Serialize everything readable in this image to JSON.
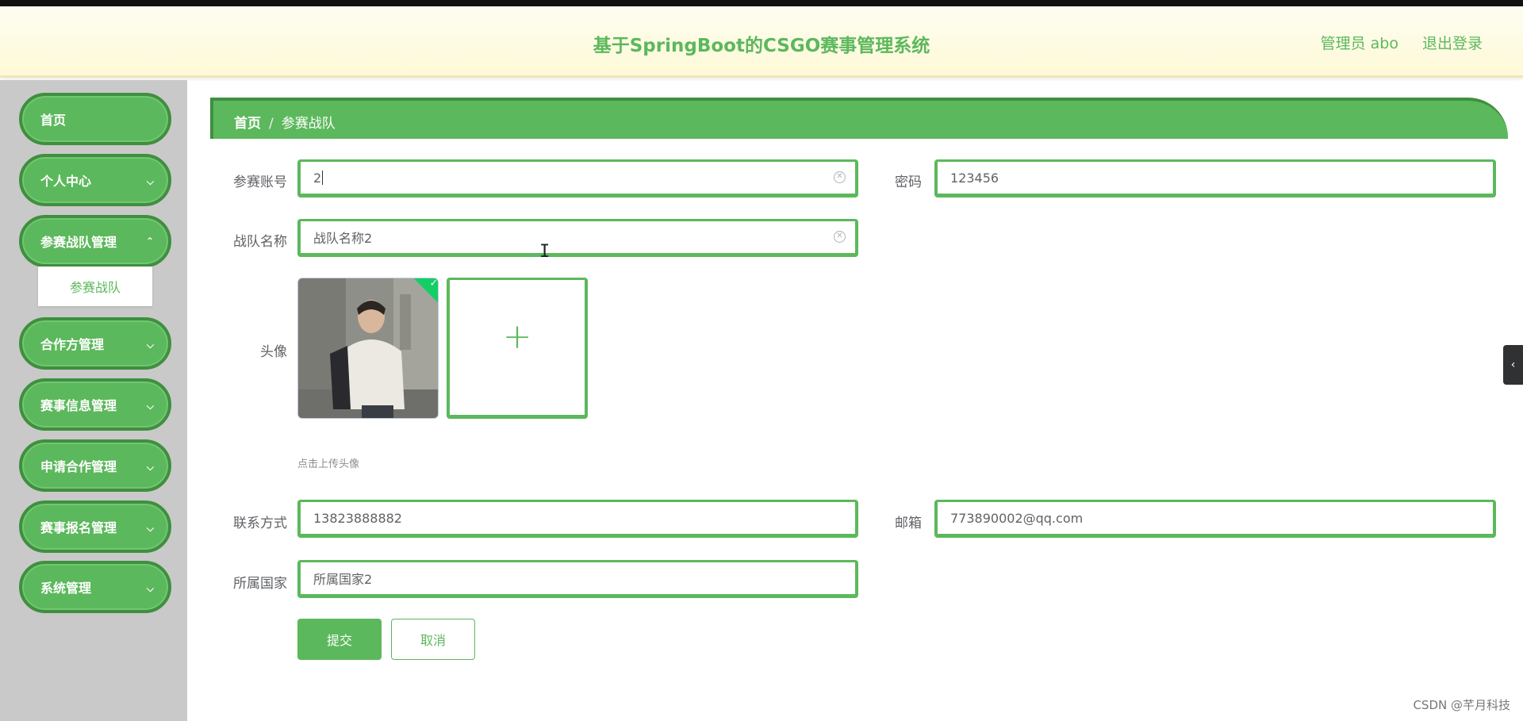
{
  "header": {
    "title": "基于SpringBoot的CSGO赛事管理系统",
    "user": "管理员 abo",
    "logout": "退出登录"
  },
  "sidebar": {
    "items": [
      {
        "label": "首页"
      },
      {
        "label": "个人中心"
      },
      {
        "label": "参赛战队管理"
      },
      {
        "label": "合作方管理"
      },
      {
        "label": "赛事信息管理"
      },
      {
        "label": "申请合作管理"
      },
      {
        "label": "赛事报名管理"
      },
      {
        "label": "系统管理"
      }
    ],
    "submenu_active": "参赛战队"
  },
  "breadcrumb": {
    "home": "首页",
    "separator": "/",
    "current": "参赛战队"
  },
  "form": {
    "account_label": "参赛账号",
    "account_value": "2",
    "password_label": "密码",
    "password_value": "123456",
    "team_name_label": "战队名称",
    "team_name_value": "战队名称2",
    "avatar_label": "头像",
    "upload_hint": "点击上传头像",
    "contact_label": "联系方式",
    "contact_value": "13823888882",
    "email_label": "邮箱",
    "email_value": "773890002@qq.com",
    "country_label": "所属国家",
    "country_value": "所属国家2",
    "submit": "提交",
    "cancel": "取消"
  },
  "icons": {
    "plus": "plus-icon",
    "clear": "clear-icon",
    "check": "check-icon",
    "chevron": "chevron-down-icon",
    "collapse": "chevron-left-icon"
  },
  "colors": {
    "accent": "#5cb85c",
    "accent_dark": "#3f8f3f",
    "sidebar_bg": "#ffe9bb",
    "header_bg": "#fff9d8"
  },
  "watermark": "CSDN @芊月科技"
}
